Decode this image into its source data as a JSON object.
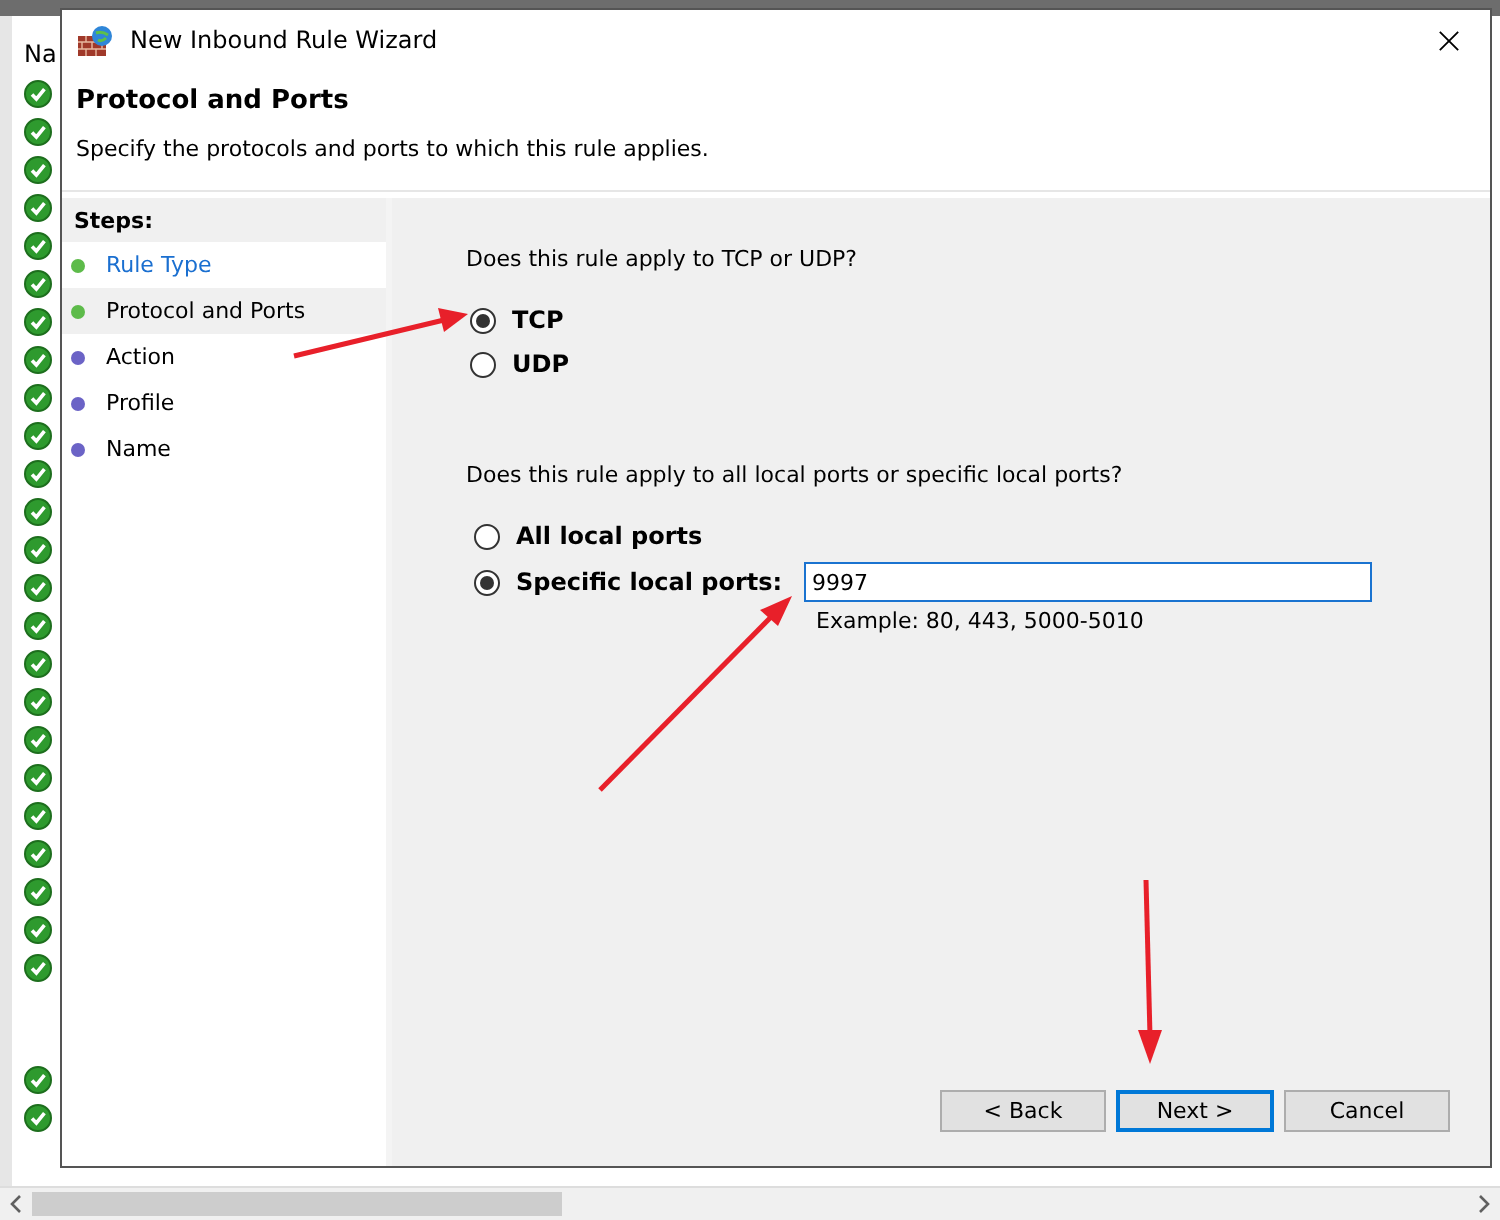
{
  "background": {
    "column_header": "Na"
  },
  "window": {
    "title": "New Inbound Rule Wizard"
  },
  "header": {
    "title": "Protocol and Ports",
    "subtitle": "Specify the protocols and ports to which this rule applies."
  },
  "steps": {
    "heading": "Steps:",
    "items": [
      {
        "label": "Rule Type",
        "completed": true,
        "selected": false
      },
      {
        "label": "Protocol and Ports",
        "completed": true,
        "selected": true
      },
      {
        "label": "Action",
        "completed": false,
        "selected": false
      },
      {
        "label": "Profile",
        "completed": false,
        "selected": false
      },
      {
        "label": "Name",
        "completed": false,
        "selected": false
      }
    ]
  },
  "protocol": {
    "question": "Does this rule apply to TCP or UDP?",
    "options": [
      {
        "label": "TCP",
        "selected": true
      },
      {
        "label": "UDP",
        "selected": false
      }
    ]
  },
  "ports": {
    "question": "Does this rule apply to all local ports or specific local ports?",
    "options": [
      {
        "label": "All local ports",
        "selected": false
      },
      {
        "label": "Specific local ports:",
        "selected": true
      }
    ],
    "value": "9997",
    "example": "Example: 80, 443, 5000-5010"
  },
  "buttons": [
    {
      "label": "< Back",
      "default": false
    },
    {
      "label": "Next >",
      "default": true
    },
    {
      "label": "Cancel",
      "default": false
    }
  ]
}
